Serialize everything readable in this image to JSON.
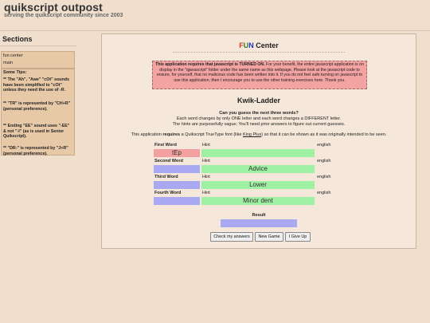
{
  "header": {
    "title": "quikscript outpost",
    "tagline": "serving the quikscript community since 2003"
  },
  "sidebar": {
    "title": "Sections",
    "nav": [
      "fun center",
      "main"
    ],
    "tips_title": "Some Tips:",
    "tips": [
      "** The \"Ah\", \"Awe\" \"cOt\" sounds have been simplified to \"cOt\" unless they need the use of -R.",
      "** \"TR\" is represented by \"CH+R\" (personal preference).",
      "** Ending \"EE\" sound uses \"-EE\" & not \"-I\" (as is used in Senior Quikscript).",
      "** \"DR-\" is represented by \"J+R\" (personal preference)."
    ]
  },
  "main": {
    "section_title": {
      "letters": [
        "F",
        "U",
        "N"
      ],
      "rest": " Center"
    },
    "notice": {
      "bold": "This application requires that javascript is TURNED ON.",
      "body": " For your benefit, the entire javascript application is on display in the \"qjavascript\" folder under the same name as this webpage. Please look at the javascript code to ensure, for yourself, that no malicious code has been written into it. If you do not feel safe turning on javascript to use this application, then I encourage you to use the other training exercises here. Thank you."
    },
    "game_title": "Kwik-Ladder",
    "question": "Can you guess the next three words?",
    "instructions": [
      "Each word changes by only ONE letter and each word changes a DIFFERENT letter.",
      "The hints are purposefully vague; You'll need prior answers to figure out current guesses."
    ],
    "requirement": {
      "pre": "This application ",
      "bold": "requires",
      "mid": " a Quikscript TrueType font (like ",
      "link": "King Plus",
      "post": ") so that it can be shown as it was originally intended to be seen."
    },
    "column_headers": {
      "hint": "Hint",
      "english": "english"
    },
    "rows": [
      {
        "label": "First Word",
        "word": "tEp",
        "hint": ""
      },
      {
        "label": "Second Word",
        "word": "",
        "hint": "Advice"
      },
      {
        "label": "Third Word",
        "word": "",
        "hint": "Lower"
      },
      {
        "label": "Fourth Word",
        "word": "",
        "hint": "Minor dent"
      }
    ],
    "result_label": "Result",
    "buttons": {
      "check": "Check my answers",
      "new_game": "New Game",
      "give_up": "I Give Up"
    }
  },
  "colors": {
    "F": "#e03020",
    "U": "#2a7a2a",
    "N": "#2030c0",
    "hint_bg": "#9ef0a2",
    "blank_bg": "#a9a9f3",
    "first_bg": "#f2a0a0"
  }
}
